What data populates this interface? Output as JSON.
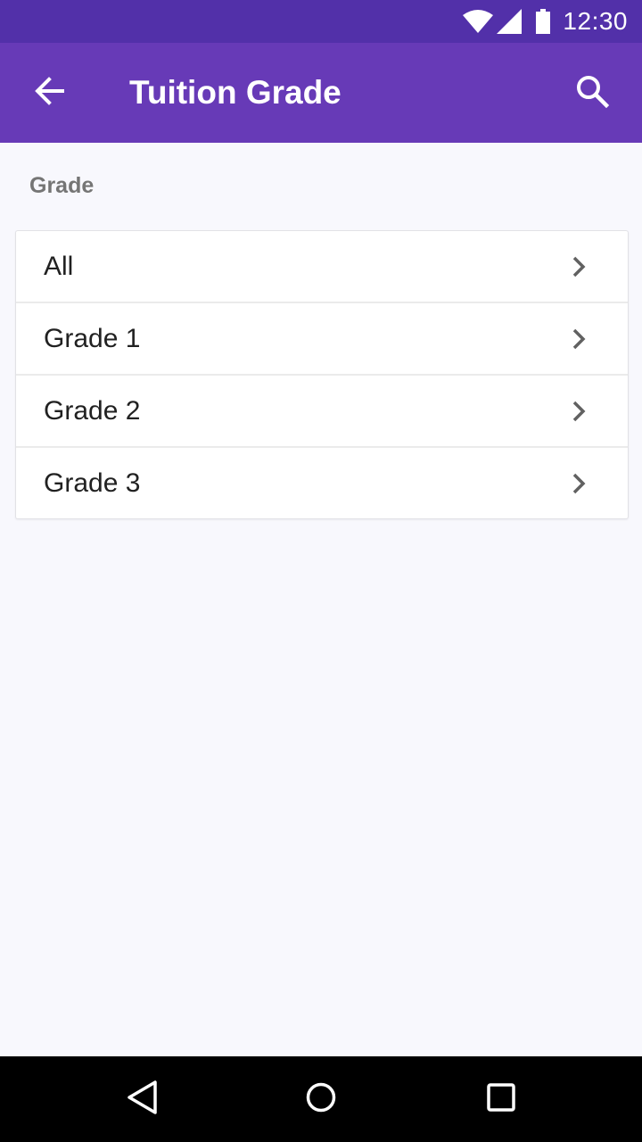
{
  "status_bar": {
    "time": "12:30",
    "icons": [
      "wifi-icon",
      "signal-icon",
      "battery-icon"
    ]
  },
  "app_bar": {
    "title": "Tuition Grade",
    "back_icon": "arrow-back-icon",
    "search_icon": "search-icon",
    "background": "#673ab7"
  },
  "section": {
    "label": "Grade"
  },
  "grades": [
    {
      "label": "All"
    },
    {
      "label": "Grade 1"
    },
    {
      "label": "Grade 2"
    },
    {
      "label": "Grade 3"
    }
  ],
  "nav_bar": {
    "icons": [
      "back-triangle-icon",
      "home-circle-icon",
      "recents-square-icon"
    ]
  },
  "colors": {
    "status_bar": "#5230a9",
    "app_bar": "#673ab7",
    "background": "#f8f8fd"
  }
}
